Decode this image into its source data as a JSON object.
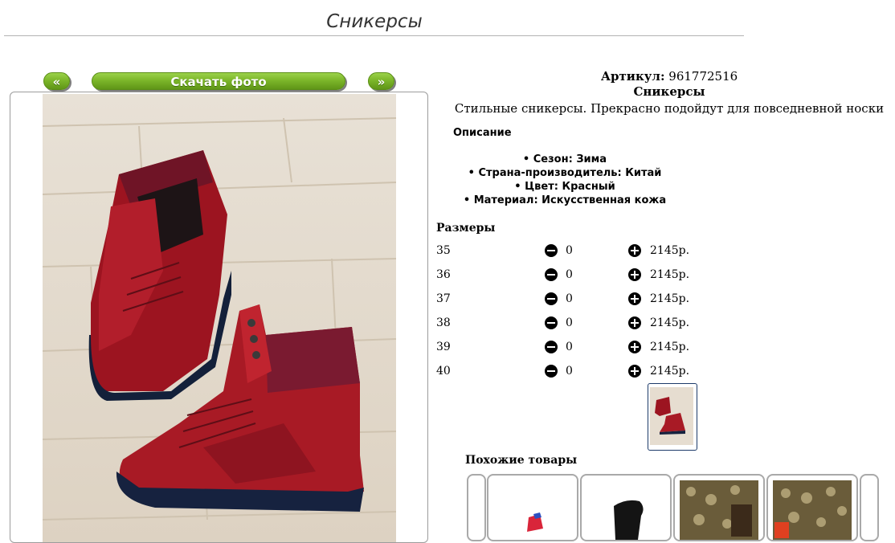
{
  "page": {
    "title": "Сникерсы"
  },
  "gallery": {
    "prev_label": "«",
    "download_label": "Скачать фото",
    "next_label": "»"
  },
  "product": {
    "article_label": "Артикул:",
    "article_value": "961772516",
    "name": "Сникерсы",
    "tagline": "Стильные сникерсы. Прекрасно подойдут для повседневной носки",
    "description_title": "Описание",
    "properties": [
      "Сезон: Зима",
      "Страна-производитель: Китай",
      "Цвет: Красный",
      "Материал: Искусственная кожа"
    ]
  },
  "sizes": {
    "title": "Размеры",
    "rows": [
      {
        "size": "35",
        "qty": "0",
        "price": "2145р."
      },
      {
        "size": "36",
        "qty": "0",
        "price": "2145р."
      },
      {
        "size": "37",
        "qty": "0",
        "price": "2145р."
      },
      {
        "size": "38",
        "qty": "0",
        "price": "2145р."
      },
      {
        "size": "39",
        "qty": "0",
        "price": "2145р."
      },
      {
        "size": "40",
        "qty": "0",
        "price": "2145р."
      }
    ]
  },
  "similar": {
    "title": "Похожие товары"
  },
  "icons": {
    "minus": "minus-circle-icon",
    "plus": "plus-circle-icon"
  }
}
